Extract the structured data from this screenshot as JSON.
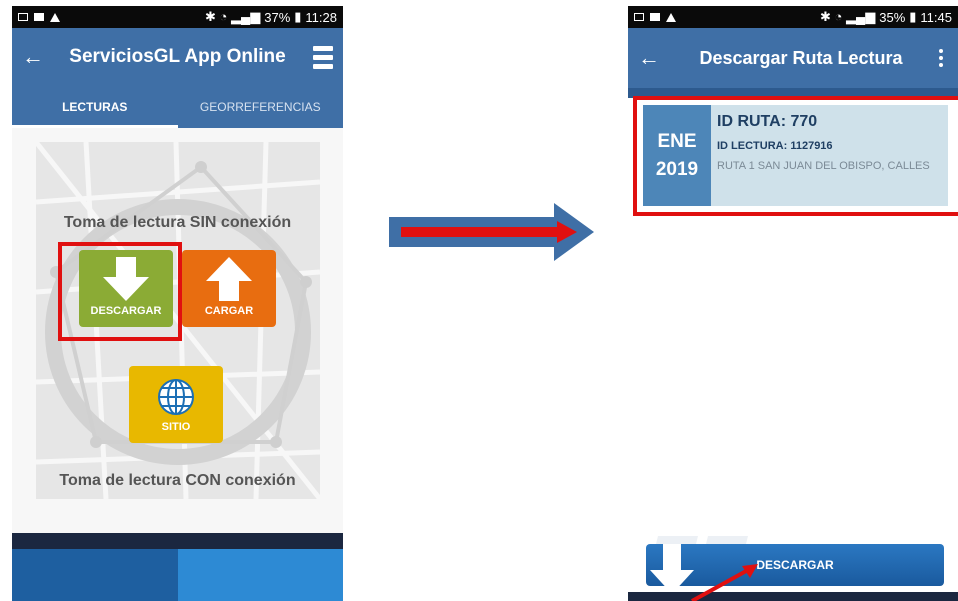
{
  "left_screen": {
    "status": {
      "battery": "37%",
      "time": "11:28"
    },
    "title": "ServiciosGL App Online",
    "tabs": [
      {
        "label": "LECTURAS",
        "active": true
      },
      {
        "label": "GEORREFERENCIAS",
        "active": false
      }
    ],
    "offline_label": "Toma de lectura SIN conexión",
    "online_label": "Toma de lectura CON conexión",
    "buttons": {
      "download": "DESCARGAR",
      "upload": "CARGAR",
      "site": "SITIO"
    },
    "colors": {
      "download": "#8bab35",
      "upload": "#e86d10",
      "site": "#e8b800",
      "appbar": "#3f6fa6",
      "highlight": "#e01010"
    },
    "icons": {
      "back": "back-arrow-icon",
      "menu": "hamburger-menu-icon",
      "download": "download-arrow-icon",
      "upload": "upload-arrow-icon",
      "site": "globe-icon"
    }
  },
  "right_screen": {
    "status": {
      "battery": "35%",
      "time": "11:45"
    },
    "title": "Descargar Ruta Lectura",
    "route_card": {
      "month": "ENE",
      "year": "2019",
      "route_id": "ID RUTA: 770",
      "reading_id": "ID LECTURA: 1127916",
      "description": "RUTA 1 SAN JUAN DEL OBISPO, CALLES"
    },
    "download_button": "DESCARGAR",
    "icons": {
      "back": "back-arrow-icon",
      "overflow": "more-vert-icon",
      "download": "download-arrow-icon"
    }
  },
  "transition_arrow": {
    "icon": "right-arrow-icon",
    "colors": [
      "#3f6fa6",
      "#e01010"
    ]
  }
}
